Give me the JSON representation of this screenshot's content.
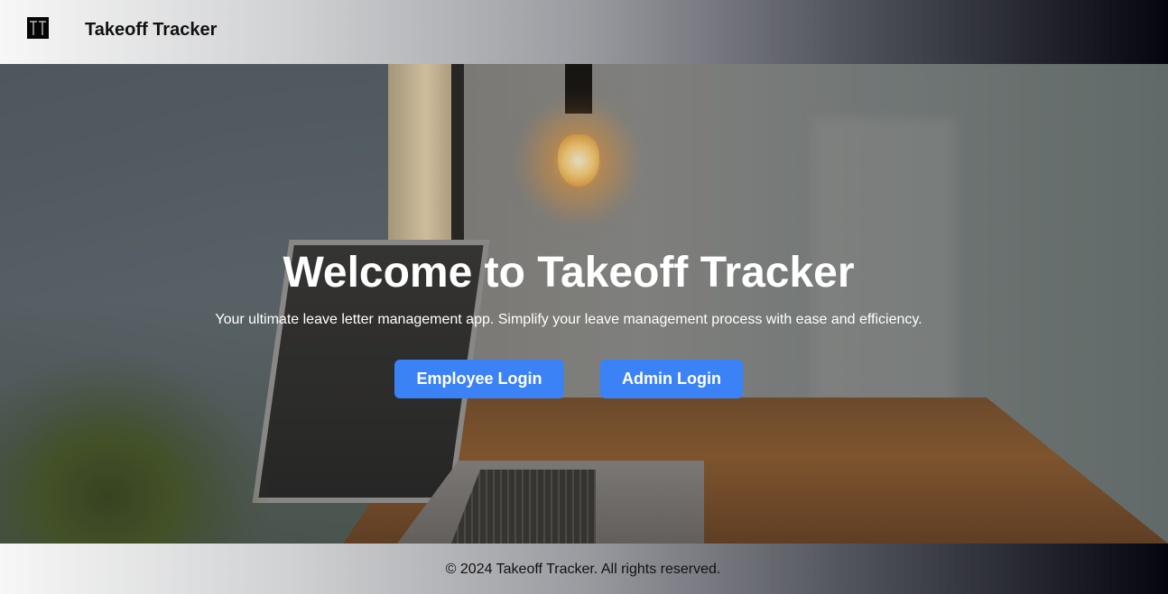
{
  "header": {
    "logo_icon": "tt-logo-icon",
    "brand": "Takeoff Tracker"
  },
  "hero": {
    "title": "Welcome to Takeoff Tracker",
    "subtitle": "Your ultimate leave letter management app. Simplify your leave management process with ease and efficiency.",
    "buttons": {
      "employee_login": "Employee Login",
      "admin_login": "Admin Login"
    },
    "background_image": "desk-laptop-lamp-photo"
  },
  "footer": {
    "copyright": "© 2024 Takeoff Tracker. All rights reserved."
  },
  "colors": {
    "accent": "#3b82f6",
    "header_gradient_start": "#f7f7f7",
    "header_gradient_end": "#04050f",
    "title_text": "#ffffff"
  }
}
